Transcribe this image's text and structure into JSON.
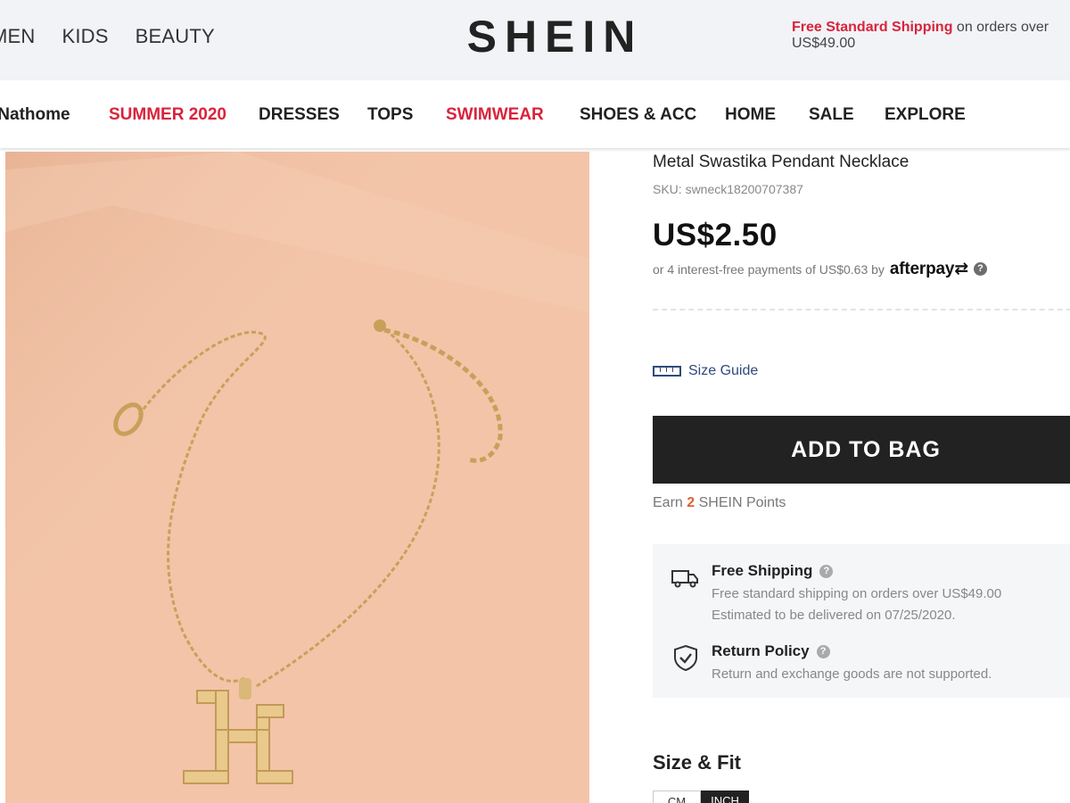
{
  "header": {
    "top_nav": [
      "MEN",
      "KIDS",
      "BEAUTY"
    ],
    "logo": "SHEIN",
    "shipping_highlight": "Free Standard Shipping",
    "shipping_rest": " on orders over US$49.00"
  },
  "category_nav": {
    "items": [
      "INathome",
      "SUMMER 2020",
      "DRESSES",
      "TOPS",
      "SWIMWEAR",
      "SHOES & ACC",
      "HOME",
      "SALE",
      "EXPLORE"
    ]
  },
  "product": {
    "title": "Metal Swastika Pendant Necklace",
    "sku": "SKU: swneck18200707387",
    "price": "US$2.50",
    "installments": "or 4 interest-free payments of US$0.63 by",
    "afterpay_brand": "afterpay",
    "size_guide": "Size Guide",
    "add_to_bag": "ADD TO BAG",
    "points_prefix": "Earn ",
    "points_value": "2",
    "points_suffix": " SHEIN Points"
  },
  "shipping_info": {
    "free_shipping_title": "Free Shipping",
    "free_shipping_line1": "Free standard shipping on orders over US$49.00",
    "free_shipping_line2": "Estimated to be delivered on 07/25/2020.",
    "return_title": "Return Policy",
    "return_line": "Return and exchange goods are not supported."
  },
  "size_fit": {
    "title": "Size & Fit",
    "units": [
      "CM",
      "INCH"
    ]
  },
  "colors": {
    "accent_red": "#d9233c",
    "points_orange": "#e0622e",
    "photo_background": "#f3c4a8",
    "button_dark": "#222222"
  },
  "icons": [
    "ruler-icon",
    "help-icon",
    "truck-icon",
    "shield-check-icon"
  ]
}
